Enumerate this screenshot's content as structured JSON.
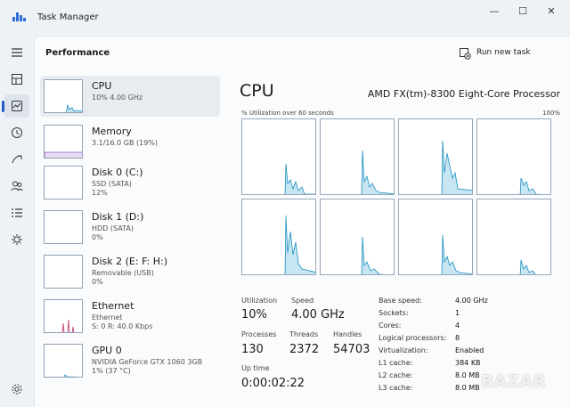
{
  "window": {
    "title": "Task Manager",
    "minimize_glyph": "—",
    "maximize_glyph": "☐",
    "close_glyph": "✕"
  },
  "rail": {
    "items": [
      "menu-icon",
      "processes-icon",
      "performance-icon",
      "app-history-icon",
      "startup-apps-icon",
      "users-icon",
      "details-icon",
      "services-icon",
      "settings-icon"
    ],
    "active": "performance-icon"
  },
  "header": {
    "title": "Performance",
    "run_new_task": "Run new task"
  },
  "devices": [
    {
      "name": "CPU",
      "sub1": "10% 4.00 GHz",
      "sub2": "",
      "sub3": ""
    },
    {
      "name": "Memory",
      "sub1": "3.1/16.0 GB (19%)",
      "sub2": "",
      "sub3": ""
    },
    {
      "name": "Disk 0 (C:)",
      "sub1": "SSD (SATA)",
      "sub2": "12%",
      "sub3": ""
    },
    {
      "name": "Disk 1 (D:)",
      "sub1": "HDD (SATA)",
      "sub2": "0%",
      "sub3": ""
    },
    {
      "name": "Disk 2 (E: F: H:)",
      "sub1": "Removable (USB)",
      "sub2": "0%",
      "sub3": ""
    },
    {
      "name": "Ethernet",
      "sub1": "Ethernet",
      "sub2": "S: 0 R: 40.0 Kbps",
      "sub3": ""
    },
    {
      "name": "GPU 0",
      "sub1": "NVIDIA GeForce GTX 1060 3GB",
      "sub2": "1% (37 °C)",
      "sub3": ""
    }
  ],
  "detail": {
    "title": "CPU",
    "model": "AMD FX(tm)-8300 Eight-Core Processor",
    "graph_label": "% Utilization over 60 seconds",
    "graph_max": "100%",
    "stats": {
      "utilization_label": "Utilization",
      "utilization": "10%",
      "speed_label": "Speed",
      "speed": "4.00 GHz",
      "processes_label": "Processes",
      "processes": "130",
      "threads_label": "Threads",
      "threads": "2372",
      "handles_label": "Handles",
      "handles": "54703",
      "uptime_label": "Up time",
      "uptime": "0:00:02:22"
    },
    "specs": [
      {
        "k": "Base speed:",
        "v": "4.00 GHz"
      },
      {
        "k": "Sockets:",
        "v": "1"
      },
      {
        "k": "Cores:",
        "v": "4"
      },
      {
        "k": "Logical processors:",
        "v": "8"
      },
      {
        "k": "Virtualization:",
        "v": "Enabled"
      },
      {
        "k": "L1 cache:",
        "v": "384 KB"
      },
      {
        "k": "L2 cache:",
        "v": "8.0 MB"
      },
      {
        "k": "L3 cache:",
        "v": "8.0 MB"
      }
    ]
  },
  "colors": {
    "cpu_line": "#1b8fbd",
    "cpu_fill": "#c7e6f2",
    "memory_line": "#8f5fc5",
    "disk_line": "#4e9a2a",
    "ethernet_line": "#c2487a",
    "gpu_line": "#1b8fbd",
    "accent": "#1f5fc1"
  },
  "watermark": "BAZAR"
}
